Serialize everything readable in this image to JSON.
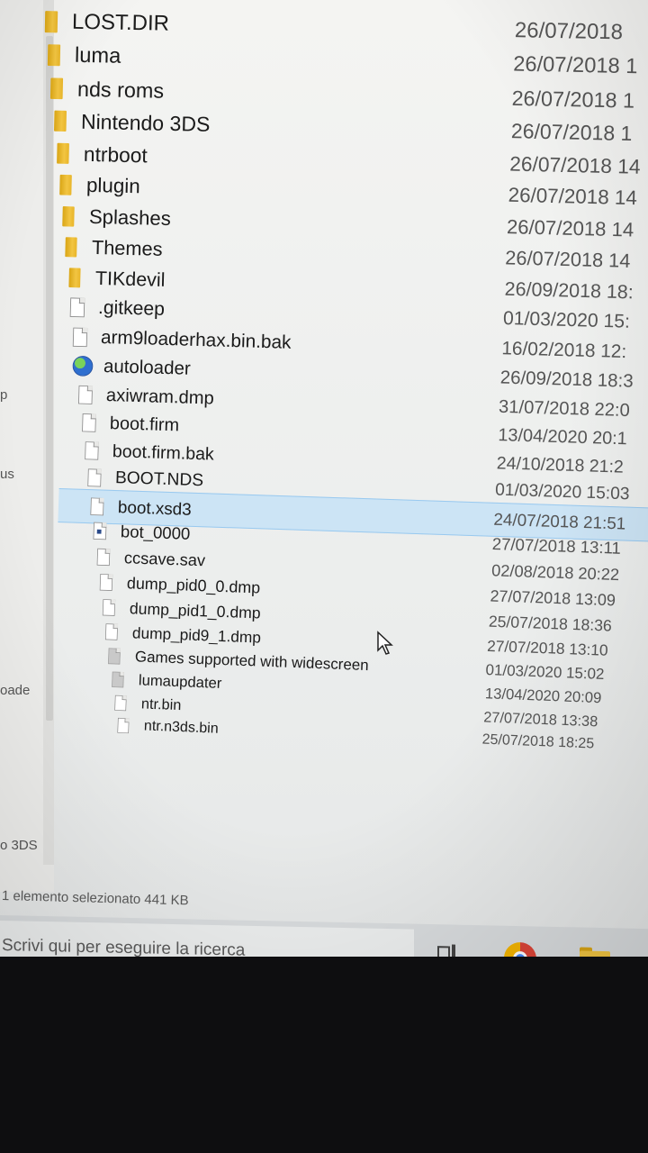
{
  "nav_pane": {
    "fragments": [
      "p",
      "us",
      "oade",
      "o 3DS"
    ]
  },
  "files": [
    {
      "name": "LOST.DIR",
      "date": "26/07/2018",
      "type": "folder-icon"
    },
    {
      "name": "luma",
      "date": "26/07/2018 1",
      "type": "folder-icon"
    },
    {
      "name": "nds roms",
      "date": "26/07/2018 1",
      "type": "folder-icon"
    },
    {
      "name": "Nintendo 3DS",
      "date": "26/07/2018 1",
      "type": "folder-icon"
    },
    {
      "name": "ntrboot",
      "date": "26/07/2018 14",
      "type": "folder-icon"
    },
    {
      "name": "plugin",
      "date": "26/07/2018 14",
      "type": "folder-icon"
    },
    {
      "name": "Splashes",
      "date": "26/07/2018 14",
      "type": "folder-icon"
    },
    {
      "name": "Themes",
      "date": "26/07/2018 14",
      "type": "folder-icon"
    },
    {
      "name": "TIKdevil",
      "date": "26/09/2018 18:",
      "type": "folder-icon"
    },
    {
      "name": ".gitkeep",
      "date": "01/03/2020 15:",
      "type": "file-icon"
    },
    {
      "name": "arm9loaderhax.bin.bak",
      "date": "16/02/2018 12:",
      "type": "file-icon"
    },
    {
      "name": "autoloader",
      "date": "26/09/2018 18:3",
      "type": "app-globe-icon"
    },
    {
      "name": "axiwram.dmp",
      "date": "31/07/2018 22:0",
      "type": "file-icon"
    },
    {
      "name": "boot.firm",
      "date": "13/04/2020 20:1",
      "type": "file-icon"
    },
    {
      "name": "boot.firm.bak",
      "date": "24/10/2018 21:2",
      "type": "file-icon"
    },
    {
      "name": "BOOT.NDS",
      "date": "01/03/2020 15:03",
      "type": "file-icon"
    },
    {
      "name": "boot.xsd3",
      "date": "24/07/2018 21:51",
      "type": "file-icon",
      "selected": true
    },
    {
      "name": "bot_0000",
      "date": "27/07/2018 13:11",
      "type": "data-file-icon"
    },
    {
      "name": "ccsave.sav",
      "date": "02/08/2018 20:22",
      "type": "file-icon"
    },
    {
      "name": "dump_pid0_0.dmp",
      "date": "27/07/2018 13:09",
      "type": "file-icon"
    },
    {
      "name": "dump_pid1_0.dmp",
      "date": "25/07/2018 18:36",
      "type": "file-icon"
    },
    {
      "name": "dump_pid9_1.dmp",
      "date": "27/07/2018 13:10",
      "type": "file-icon"
    },
    {
      "name": "Games supported with widescreen",
      "date": "01/03/2020 15:02",
      "type": "text-file-icon"
    },
    {
      "name": "lumaupdater",
      "date": "13/04/2020 20:09",
      "type": "text-file-icon"
    },
    {
      "name": "ntr.bin",
      "date": "27/07/2018 13:38",
      "type": "file-icon"
    },
    {
      "name": "ntr.n3ds.bin",
      "date": "25/07/2018 18:25",
      "type": "file-icon"
    }
  ],
  "status_bar": {
    "text": "1 elemento selezionato  441 KB"
  },
  "taskbar": {
    "search_placeholder": "Scrivi qui per eseguire la ricerca"
  }
}
